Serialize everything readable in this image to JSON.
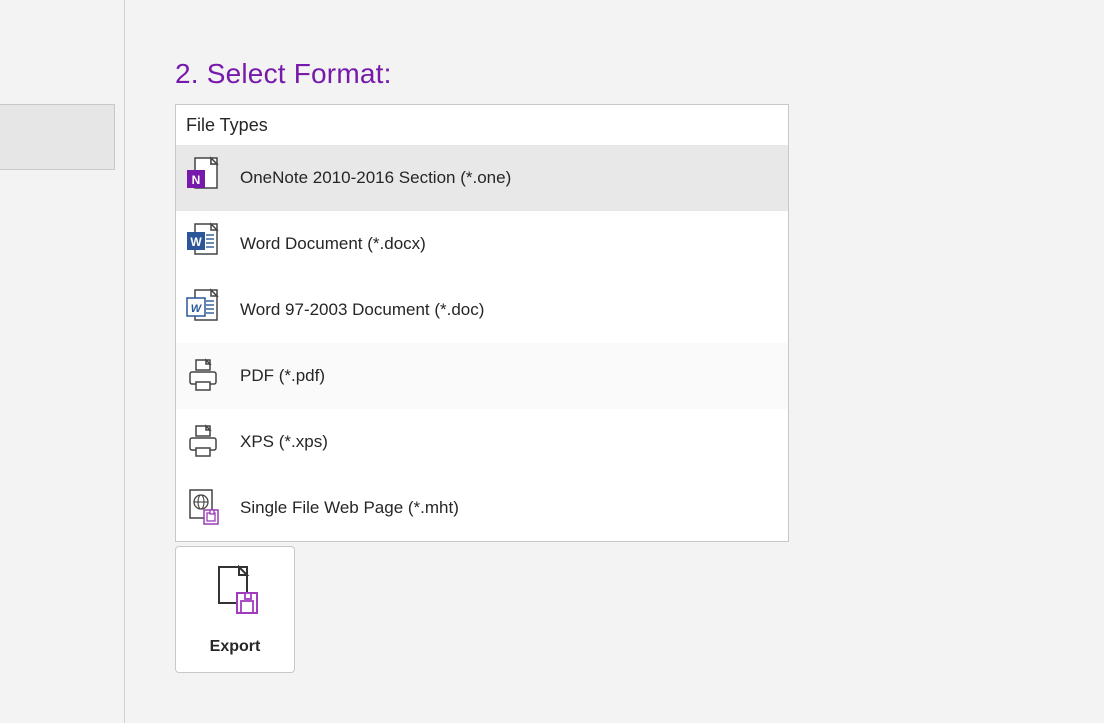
{
  "heading": "2. Select Format:",
  "fileTypes": {
    "header": "File Types",
    "items": [
      {
        "label": "OneNote 2010-2016 Section (*.one)"
      },
      {
        "label": "Word Document (*.docx)"
      },
      {
        "label": "Word 97-2003 Document (*.doc)"
      },
      {
        "label": "PDF (*.pdf)"
      },
      {
        "label": "XPS (*.xps)"
      },
      {
        "label": "Single File Web Page (*.mht)"
      }
    ]
  },
  "exportButton": {
    "label": "Export"
  }
}
